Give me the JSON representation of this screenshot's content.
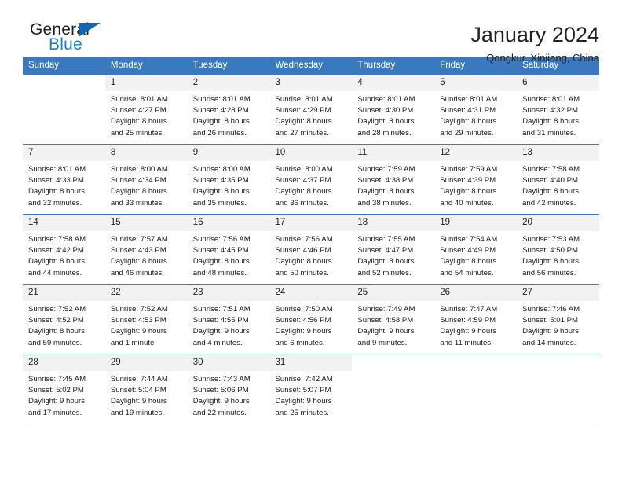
{
  "brand": {
    "name_top": "General",
    "name_bottom": "Blue",
    "triangle_color": "#1567ad",
    "blue_color": "#1b7fc4"
  },
  "header": {
    "title": "January 2024",
    "subtitle": "Qongkur, Xinjiang, China"
  },
  "theme": {
    "header_blue": "#3a79bd",
    "date_cell_gray": "#f2f2f2"
  },
  "weekdays": [
    "Sunday",
    "Monday",
    "Tuesday",
    "Wednesday",
    "Thursday",
    "Friday",
    "Saturday"
  ],
  "weeks": [
    {
      "days": [
        {
          "date": "",
          "sunrise": "",
          "sunset": "",
          "daylight1": "",
          "daylight2": ""
        },
        {
          "date": "1",
          "sunrise": "Sunrise: 8:01 AM",
          "sunset": "Sunset: 4:27 PM",
          "daylight1": "Daylight: 8 hours",
          "daylight2": "and 25 minutes."
        },
        {
          "date": "2",
          "sunrise": "Sunrise: 8:01 AM",
          "sunset": "Sunset: 4:28 PM",
          "daylight1": "Daylight: 8 hours",
          "daylight2": "and 26 minutes."
        },
        {
          "date": "3",
          "sunrise": "Sunrise: 8:01 AM",
          "sunset": "Sunset: 4:29 PM",
          "daylight1": "Daylight: 8 hours",
          "daylight2": "and 27 minutes."
        },
        {
          "date": "4",
          "sunrise": "Sunrise: 8:01 AM",
          "sunset": "Sunset: 4:30 PM",
          "daylight1": "Daylight: 8 hours",
          "daylight2": "and 28 minutes."
        },
        {
          "date": "5",
          "sunrise": "Sunrise: 8:01 AM",
          "sunset": "Sunset: 4:31 PM",
          "daylight1": "Daylight: 8 hours",
          "daylight2": "and 29 minutes."
        },
        {
          "date": "6",
          "sunrise": "Sunrise: 8:01 AM",
          "sunset": "Sunset: 4:32 PM",
          "daylight1": "Daylight: 8 hours",
          "daylight2": "and 31 minutes."
        }
      ]
    },
    {
      "days": [
        {
          "date": "7",
          "sunrise": "Sunrise: 8:01 AM",
          "sunset": "Sunset: 4:33 PM",
          "daylight1": "Daylight: 8 hours",
          "daylight2": "and 32 minutes."
        },
        {
          "date": "8",
          "sunrise": "Sunrise: 8:00 AM",
          "sunset": "Sunset: 4:34 PM",
          "daylight1": "Daylight: 8 hours",
          "daylight2": "and 33 minutes."
        },
        {
          "date": "9",
          "sunrise": "Sunrise: 8:00 AM",
          "sunset": "Sunset: 4:35 PM",
          "daylight1": "Daylight: 8 hours",
          "daylight2": "and 35 minutes."
        },
        {
          "date": "10",
          "sunrise": "Sunrise: 8:00 AM",
          "sunset": "Sunset: 4:37 PM",
          "daylight1": "Daylight: 8 hours",
          "daylight2": "and 36 minutes."
        },
        {
          "date": "11",
          "sunrise": "Sunrise: 7:59 AM",
          "sunset": "Sunset: 4:38 PM",
          "daylight1": "Daylight: 8 hours",
          "daylight2": "and 38 minutes."
        },
        {
          "date": "12",
          "sunrise": "Sunrise: 7:59 AM",
          "sunset": "Sunset: 4:39 PM",
          "daylight1": "Daylight: 8 hours",
          "daylight2": "and 40 minutes."
        },
        {
          "date": "13",
          "sunrise": "Sunrise: 7:58 AM",
          "sunset": "Sunset: 4:40 PM",
          "daylight1": "Daylight: 8 hours",
          "daylight2": "and 42 minutes."
        }
      ]
    },
    {
      "days": [
        {
          "date": "14",
          "sunrise": "Sunrise: 7:58 AM",
          "sunset": "Sunset: 4:42 PM",
          "daylight1": "Daylight: 8 hours",
          "daylight2": "and 44 minutes."
        },
        {
          "date": "15",
          "sunrise": "Sunrise: 7:57 AM",
          "sunset": "Sunset: 4:43 PM",
          "daylight1": "Daylight: 8 hours",
          "daylight2": "and 46 minutes."
        },
        {
          "date": "16",
          "sunrise": "Sunrise: 7:56 AM",
          "sunset": "Sunset: 4:45 PM",
          "daylight1": "Daylight: 8 hours",
          "daylight2": "and 48 minutes."
        },
        {
          "date": "17",
          "sunrise": "Sunrise: 7:56 AM",
          "sunset": "Sunset: 4:46 PM",
          "daylight1": "Daylight: 8 hours",
          "daylight2": "and 50 minutes."
        },
        {
          "date": "18",
          "sunrise": "Sunrise: 7:55 AM",
          "sunset": "Sunset: 4:47 PM",
          "daylight1": "Daylight: 8 hours",
          "daylight2": "and 52 minutes."
        },
        {
          "date": "19",
          "sunrise": "Sunrise: 7:54 AM",
          "sunset": "Sunset: 4:49 PM",
          "daylight1": "Daylight: 8 hours",
          "daylight2": "and 54 minutes."
        },
        {
          "date": "20",
          "sunrise": "Sunrise: 7:53 AM",
          "sunset": "Sunset: 4:50 PM",
          "daylight1": "Daylight: 8 hours",
          "daylight2": "and 56 minutes."
        }
      ]
    },
    {
      "days": [
        {
          "date": "21",
          "sunrise": "Sunrise: 7:52 AM",
          "sunset": "Sunset: 4:52 PM",
          "daylight1": "Daylight: 8 hours",
          "daylight2": "and 59 minutes."
        },
        {
          "date": "22",
          "sunrise": "Sunrise: 7:52 AM",
          "sunset": "Sunset: 4:53 PM",
          "daylight1": "Daylight: 9 hours",
          "daylight2": "and 1 minute."
        },
        {
          "date": "23",
          "sunrise": "Sunrise: 7:51 AM",
          "sunset": "Sunset: 4:55 PM",
          "daylight1": "Daylight: 9 hours",
          "daylight2": "and 4 minutes."
        },
        {
          "date": "24",
          "sunrise": "Sunrise: 7:50 AM",
          "sunset": "Sunset: 4:56 PM",
          "daylight1": "Daylight: 9 hours",
          "daylight2": "and 6 minutes."
        },
        {
          "date": "25",
          "sunrise": "Sunrise: 7:49 AM",
          "sunset": "Sunset: 4:58 PM",
          "daylight1": "Daylight: 9 hours",
          "daylight2": "and 9 minutes."
        },
        {
          "date": "26",
          "sunrise": "Sunrise: 7:47 AM",
          "sunset": "Sunset: 4:59 PM",
          "daylight1": "Daylight: 9 hours",
          "daylight2": "and 11 minutes."
        },
        {
          "date": "27",
          "sunrise": "Sunrise: 7:46 AM",
          "sunset": "Sunset: 5:01 PM",
          "daylight1": "Daylight: 9 hours",
          "daylight2": "and 14 minutes."
        }
      ]
    },
    {
      "days": [
        {
          "date": "28",
          "sunrise": "Sunrise: 7:45 AM",
          "sunset": "Sunset: 5:02 PM",
          "daylight1": "Daylight: 9 hours",
          "daylight2": "and 17 minutes."
        },
        {
          "date": "29",
          "sunrise": "Sunrise: 7:44 AM",
          "sunset": "Sunset: 5:04 PM",
          "daylight1": "Daylight: 9 hours",
          "daylight2": "and 19 minutes."
        },
        {
          "date": "30",
          "sunrise": "Sunrise: 7:43 AM",
          "sunset": "Sunset: 5:06 PM",
          "daylight1": "Daylight: 9 hours",
          "daylight2": "and 22 minutes."
        },
        {
          "date": "31",
          "sunrise": "Sunrise: 7:42 AM",
          "sunset": "Sunset: 5:07 PM",
          "daylight1": "Daylight: 9 hours",
          "daylight2": "and 25 minutes."
        },
        {
          "date": "",
          "sunrise": "",
          "sunset": "",
          "daylight1": "",
          "daylight2": ""
        },
        {
          "date": "",
          "sunrise": "",
          "sunset": "",
          "daylight1": "",
          "daylight2": ""
        },
        {
          "date": "",
          "sunrise": "",
          "sunset": "",
          "daylight1": "",
          "daylight2": ""
        }
      ]
    }
  ]
}
